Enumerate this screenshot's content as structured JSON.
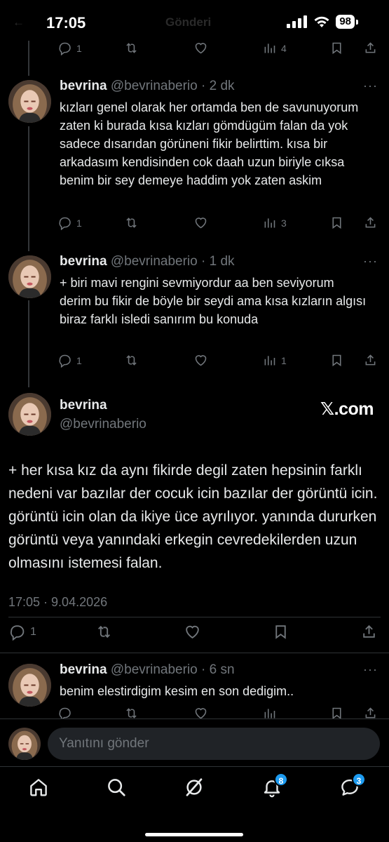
{
  "status_bar": {
    "time": "17:05",
    "battery": "98",
    "ghost_text": "Gönderi",
    "ghost_left": "←"
  },
  "top_actions": {
    "reply_count": "1",
    "views_count": "4"
  },
  "tweets": [
    {
      "name": "bevrina",
      "handle": "@bevrinaberio",
      "time": "2 dk",
      "text": "kızları genel olarak her ortamda ben de savunuyorum zaten ki burada kısa kızları gömdügüm falan da yok sadece dısarıdan görüneni fikir belirttim. kısa bir arkadasım kendisinden cok daah uzun biriyle cıksa benim bir sey demeye haddim yok zaten askim",
      "reply_count": "1",
      "views_count": "3"
    },
    {
      "name": "bevrina",
      "handle": "@bevrinaberio",
      "time": "1 dk",
      "text": "+ biri mavi rengini sevmiyordur aa ben seviyorum derim bu fikir de böyle bir seydi ama kısa kızların algısı biraz farklı isledi sanırım bu konuda",
      "reply_count": "1",
      "views_count": "1"
    }
  ],
  "focused_tweet": {
    "name": "bevrina",
    "handle": "@bevrinaberio",
    "watermark": "𝕏.com",
    "text": "+ her kısa kız da aynı fikirde degil zaten hepsinin farklı nedeni var bazılar der cocuk icin bazılar der görüntü icin. görüntü icin olan da ikiye üce ayrılıyor. yanında dururken görüntü veya yanındaki erkegin cevredekilerden uzun olmasını istemesi falan.",
    "timestamp": "17:05 · 9.04.2026",
    "reply_count": "1"
  },
  "reply_tweet": {
    "name": "bevrina",
    "handle": "@bevrinaberio",
    "time": "6 sn",
    "text": "benim elestirdigim kesim en son dedigim.."
  },
  "reply_bar": {
    "placeholder": "Yanıtını gönder"
  },
  "bottom_nav": {
    "notifications_badge": "8",
    "messages_badge": "3"
  },
  "colors": {
    "background": "#000000",
    "text": "#e7e9ea",
    "muted": "#71767b",
    "accent": "#1d9bf0",
    "divider": "#2f3336"
  }
}
